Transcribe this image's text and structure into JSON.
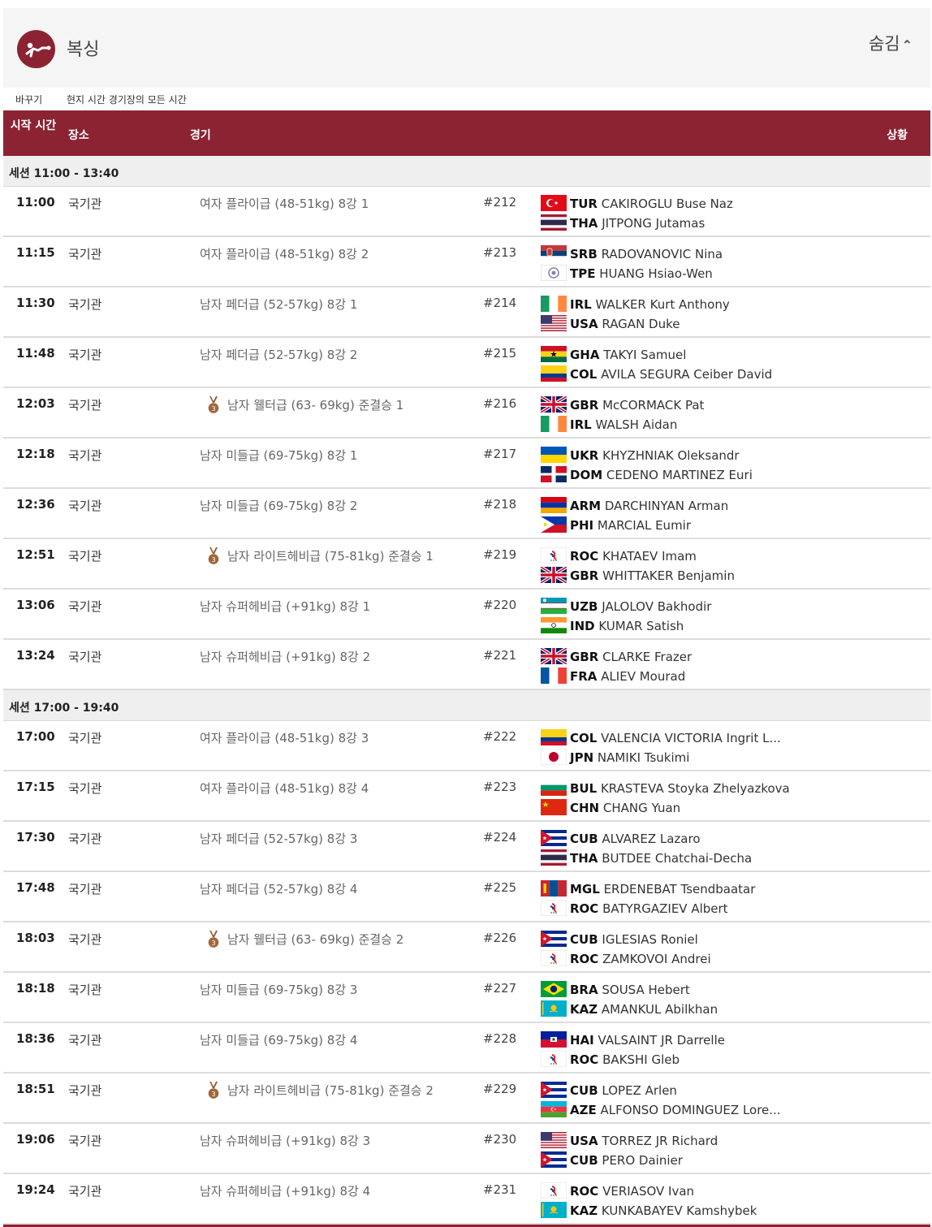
{
  "header": {
    "title": "복싱",
    "hide_label": "숨김",
    "chevron": "⌃"
  },
  "timebar": {
    "switch_label": "바꾸기",
    "mode_label": "현지 시간 경기장의 모든 시간"
  },
  "columns": {
    "time": "시작 시간",
    "venue": "장소",
    "event": "경기",
    "status": "상황"
  },
  "colors": {
    "accent": "#8b2332",
    "bronze": "#a0673a"
  },
  "sessions": [
    {
      "label": "세션  11:00 - 13:40",
      "rows": [
        {
          "time": "11:00",
          "venue": "국기관",
          "event": "여자 플라이급 (48-51kg) 8강 1",
          "medal": false,
          "num": "#212",
          "a": {
            "flag": "TUR",
            "code": "TUR",
            "name": "CAKIROGLU Buse Naz"
          },
          "b": {
            "flag": "THA",
            "code": "THA",
            "name": "JITPONG Jutamas"
          }
        },
        {
          "time": "11:15",
          "venue": "국기관",
          "event": "여자 플라이급 (48-51kg) 8강 2",
          "medal": false,
          "num": "#213",
          "a": {
            "flag": "SRB",
            "code": "SRB",
            "name": "RADOVANOVIC Nina"
          },
          "b": {
            "flag": "TPE",
            "code": "TPE",
            "name": "HUANG Hsiao-Wen"
          }
        },
        {
          "time": "11:30",
          "venue": "국기관",
          "event": "남자 페더급 (52-57kg) 8강 1",
          "medal": false,
          "num": "#214",
          "a": {
            "flag": "IRL",
            "code": "IRL",
            "name": "WALKER Kurt Anthony"
          },
          "b": {
            "flag": "USA",
            "code": "USA",
            "name": "RAGAN Duke"
          }
        },
        {
          "time": "11:48",
          "venue": "국기관",
          "event": "남자 페더급 (52-57kg) 8강 2",
          "medal": false,
          "num": "#215",
          "a": {
            "flag": "GHA",
            "code": "GHA",
            "name": "TAKYI Samuel"
          },
          "b": {
            "flag": "COL",
            "code": "COL",
            "name": "AVILA SEGURA Ceiber David"
          }
        },
        {
          "time": "12:03",
          "venue": "국기관",
          "event": "남자 웰터급 (63- 69kg) 준결승 1",
          "medal": true,
          "num": "#216",
          "a": {
            "flag": "GBR",
            "code": "GBR",
            "name": "McCORMACK Pat"
          },
          "b": {
            "flag": "IRL",
            "code": "IRL",
            "name": "WALSH Aidan"
          }
        },
        {
          "time": "12:18",
          "venue": "국기관",
          "event": "남자 미들급 (69-75kg) 8강 1",
          "medal": false,
          "num": "#217",
          "a": {
            "flag": "UKR",
            "code": "UKR",
            "name": "KHYZHNIAK Oleksandr"
          },
          "b": {
            "flag": "DOM",
            "code": "DOM",
            "name": "CEDENO MARTINEZ Euri"
          }
        },
        {
          "time": "12:36",
          "venue": "국기관",
          "event": "남자 미들급 (69-75kg) 8강 2",
          "medal": false,
          "num": "#218",
          "a": {
            "flag": "ARM",
            "code": "ARM",
            "name": "DARCHINYAN Arman"
          },
          "b": {
            "flag": "PHI",
            "code": "PHI",
            "name": "MARCIAL Eumir"
          }
        },
        {
          "time": "12:51",
          "venue": "국기관",
          "event": "남자 라이트헤비급 (75-81kg) 준결승 1",
          "medal": true,
          "num": "#219",
          "a": {
            "flag": "ROC",
            "code": "ROC",
            "name": "KHATAEV Imam"
          },
          "b": {
            "flag": "GBR",
            "code": "GBR",
            "name": "WHITTAKER Benjamin"
          }
        },
        {
          "time": "13:06",
          "venue": "국기관",
          "event": "남자 슈퍼헤비급 (+91kg) 8강 1",
          "medal": false,
          "num": "#220",
          "a": {
            "flag": "UZB",
            "code": "UZB",
            "name": "JALOLOV Bakhodir"
          },
          "b": {
            "flag": "IND",
            "code": "IND",
            "name": "KUMAR Satish"
          }
        },
        {
          "time": "13:24",
          "venue": "국기관",
          "event": "남자 슈퍼헤비급 (+91kg) 8강 2",
          "medal": false,
          "num": "#221",
          "a": {
            "flag": "GBR",
            "code": "GBR",
            "name": "CLARKE Frazer"
          },
          "b": {
            "flag": "FRA",
            "code": "FRA",
            "name": "ALIEV Mourad"
          }
        }
      ]
    },
    {
      "label": "세션  17:00 - 19:40",
      "rows": [
        {
          "time": "17:00",
          "venue": "국기관",
          "event": "여자 플라이급 (48-51kg) 8강 3",
          "medal": false,
          "num": "#222",
          "a": {
            "flag": "COL",
            "code": "COL",
            "name": "VALENCIA VICTORIA Ingrit L..."
          },
          "b": {
            "flag": "JPN",
            "code": "JPN",
            "name": "NAMIKI Tsukimi"
          }
        },
        {
          "time": "17:15",
          "venue": "국기관",
          "event": "여자 플라이급 (48-51kg) 8강 4",
          "medal": false,
          "num": "#223",
          "a": {
            "flag": "BUL",
            "code": "BUL",
            "name": "KRASTEVA Stoyka Zhelyazkova"
          },
          "b": {
            "flag": "CHN",
            "code": "CHN",
            "name": "CHANG Yuan"
          }
        },
        {
          "time": "17:30",
          "venue": "국기관",
          "event": "남자 페더급 (52-57kg) 8강 3",
          "medal": false,
          "num": "#224",
          "a": {
            "flag": "CUB",
            "code": "CUB",
            "name": "ALVAREZ Lazaro"
          },
          "b": {
            "flag": "THA",
            "code": "THA",
            "name": "BUTDEE Chatchai-Decha"
          }
        },
        {
          "time": "17:48",
          "venue": "국기관",
          "event": "남자 페더급 (52-57kg) 8강 4",
          "medal": false,
          "num": "#225",
          "a": {
            "flag": "MGL",
            "code": "MGL",
            "name": "ERDENEBAT Tsendbaatar"
          },
          "b": {
            "flag": "ROC",
            "code": "ROC",
            "name": "BATYRGAZIEV Albert"
          }
        },
        {
          "time": "18:03",
          "venue": "국기관",
          "event": "남자 웰터급 (63- 69kg) 준결승 2",
          "medal": true,
          "num": "#226",
          "a": {
            "flag": "CUB",
            "code": "CUB",
            "name": "IGLESIAS Roniel"
          },
          "b": {
            "flag": "ROC",
            "code": "ROC",
            "name": "ZAMKOVOI Andrei"
          }
        },
        {
          "time": "18:18",
          "venue": "국기관",
          "event": "남자 미들급 (69-75kg) 8강 3",
          "medal": false,
          "num": "#227",
          "a": {
            "flag": "BRA",
            "code": "BRA",
            "name": "SOUSA Hebert"
          },
          "b": {
            "flag": "KAZ",
            "code": "KAZ",
            "name": "AMANKUL Abilkhan"
          }
        },
        {
          "time": "18:36",
          "venue": "국기관",
          "event": "남자 미들급 (69-75kg) 8강 4",
          "medal": false,
          "num": "#228",
          "a": {
            "flag": "HAI",
            "code": "HAI",
            "name": "VALSAINT JR Darrelle"
          },
          "b": {
            "flag": "ROC",
            "code": "ROC",
            "name": "BAKSHI Gleb"
          }
        },
        {
          "time": "18:51",
          "venue": "국기관",
          "event": "남자 라이트헤비급 (75-81kg) 준결승 2",
          "medal": true,
          "num": "#229",
          "a": {
            "flag": "CUB",
            "code": "CUB",
            "name": "LOPEZ Arlen"
          },
          "b": {
            "flag": "AZE",
            "code": "AZE",
            "name": "ALFONSO DOMINGUEZ Lore..."
          }
        },
        {
          "time": "19:06",
          "venue": "국기관",
          "event": "남자 슈퍼헤비급 (+91kg) 8강 3",
          "medal": false,
          "num": "#230",
          "a": {
            "flag": "USA",
            "code": "USA",
            "name": "TORREZ JR Richard"
          },
          "b": {
            "flag": "CUB",
            "code": "CUB",
            "name": "PERO Dainier"
          }
        },
        {
          "time": "19:24",
          "venue": "국기관",
          "event": "남자 슈퍼헤비급 (+91kg) 8강 4",
          "medal": false,
          "num": "#231",
          "a": {
            "flag": "ROC",
            "code": "ROC",
            "name": "VERIASOV Ivan"
          },
          "b": {
            "flag": "KAZ",
            "code": "KAZ",
            "name": "KUNKABAYEV Kamshybek"
          }
        }
      ]
    }
  ]
}
